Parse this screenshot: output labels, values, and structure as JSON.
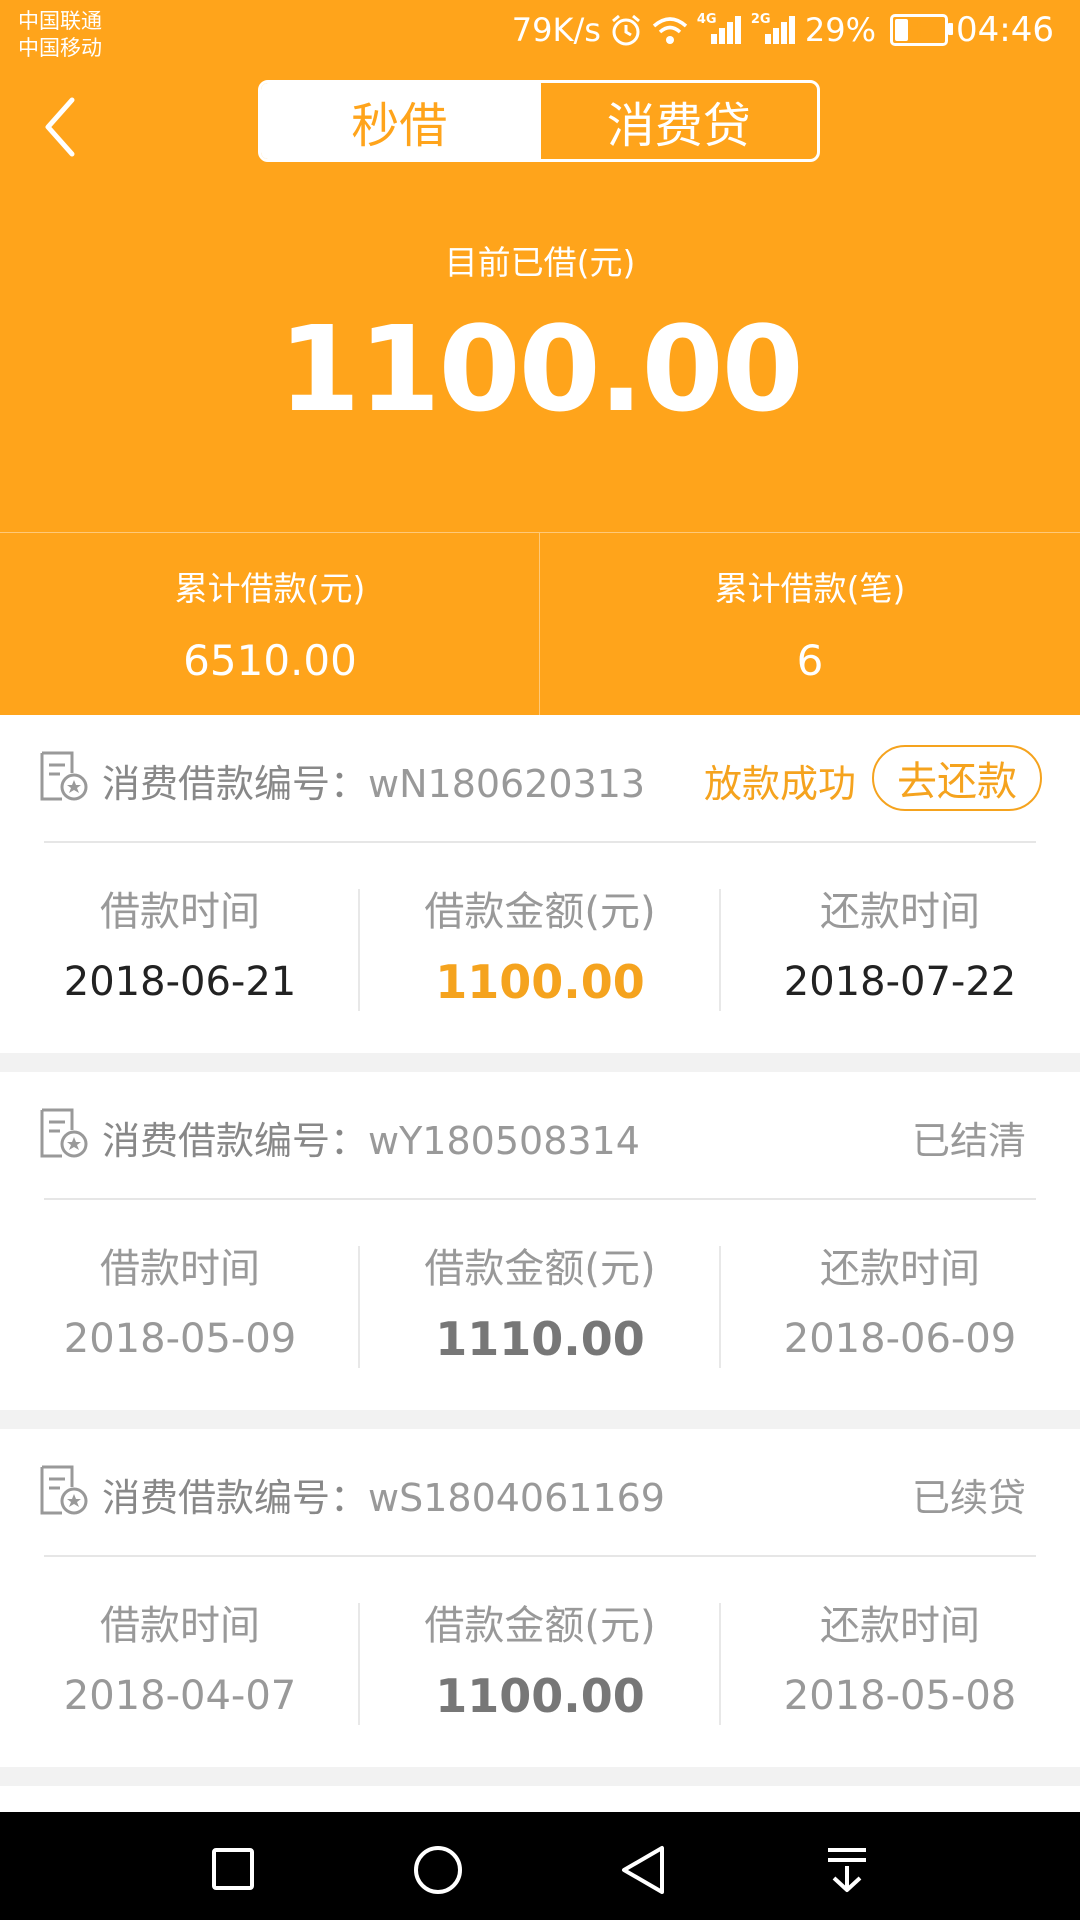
{
  "status_bar": {
    "carrier1": "中国联通",
    "carrier2": "中国移动",
    "speed": "79K/s",
    "net1": "4G",
    "net2": "2G",
    "battery": "29%",
    "battery_level": 0.29,
    "time": "04:46"
  },
  "header": {
    "tabs": [
      {
        "label": "秒借",
        "active": true
      },
      {
        "label": "消费贷",
        "active": false
      }
    ]
  },
  "summary": {
    "current_label": "目前已借(元)",
    "current_amount": "1100.00",
    "total_amount_label": "累计借款(元)",
    "total_amount": "6510.00",
    "total_count_label": "累计借款(笔)",
    "total_count": "6"
  },
  "loans": [
    {
      "no_label": "消费借款编号：",
      "no": "wN180620313",
      "status": "放款成功",
      "action": "去还款",
      "borrow_time_label": "借款时间",
      "borrow_time": "2018-06-21",
      "amount_label": "借款金额(元)",
      "amount": "1100.00",
      "repay_time_label": "还款时间",
      "repay_time": "2018-07-22"
    },
    {
      "no_label": "消费借款编号：",
      "no": "wY180508314",
      "status": "已结清",
      "borrow_time_label": "借款时间",
      "borrow_time": "2018-05-09",
      "amount_label": "借款金额(元)",
      "amount": "1110.00",
      "repay_time_label": "还款时间",
      "repay_time": "2018-06-09"
    },
    {
      "no_label": "消费借款编号：",
      "no": "wS1804061169",
      "status": "已续贷",
      "borrow_time_label": "借款时间",
      "borrow_time": "2018-04-07",
      "amount_label": "借款金额(元)",
      "amount": "1100.00",
      "repay_time_label": "还款时间",
      "repay_time": "2018-05-08"
    }
  ],
  "colors": {
    "brand": "#ffa41b",
    "accent": "#f5a31e"
  }
}
